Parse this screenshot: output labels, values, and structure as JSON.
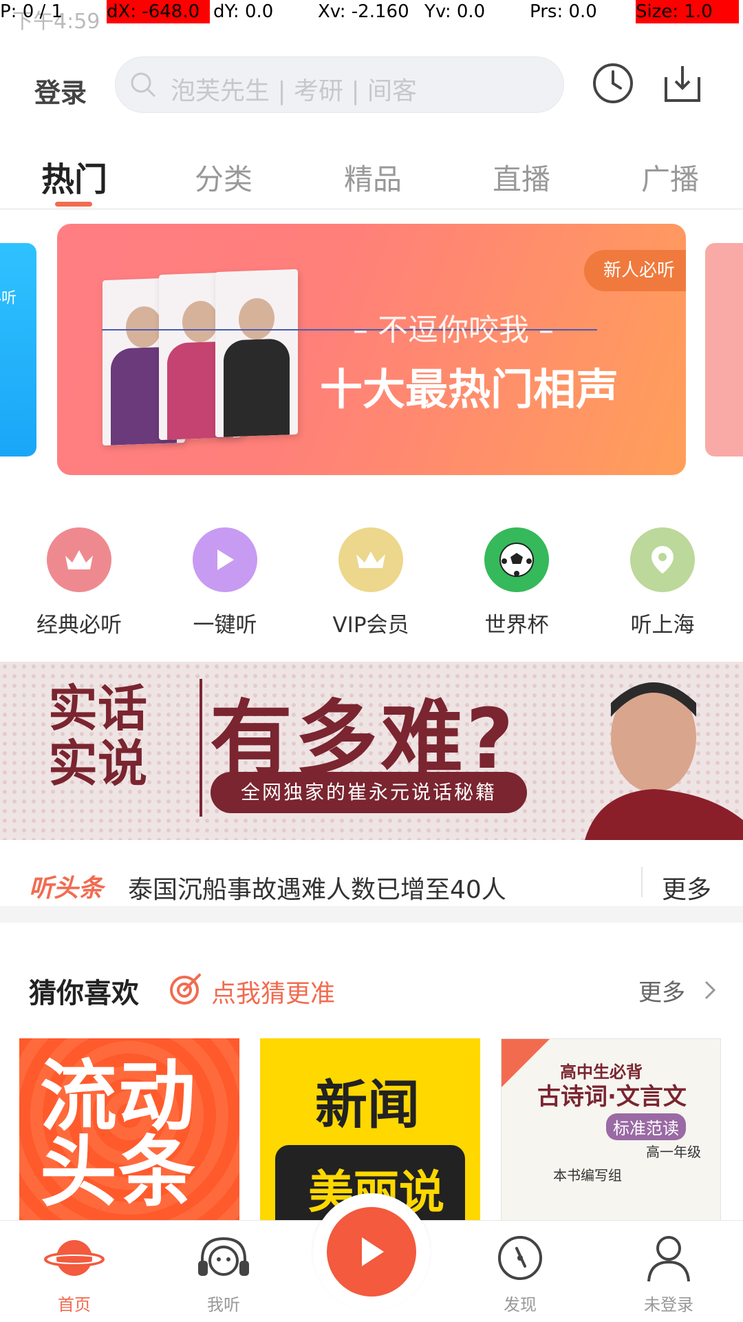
{
  "status_bar": {
    "time": "下午4:59"
  },
  "debug_overlay": {
    "pointer": "P: 0 / 1",
    "dx": "dX: -648.0",
    "dy": "dY: 0.0",
    "xv": "Xv: -2.160",
    "yv": "Yv: 0.0",
    "prs": "Prs: 0.0",
    "size": "Size: 1.0"
  },
  "header": {
    "login_label": "登录",
    "search_placeholder": "泡芙先生 | 考研 | 间客"
  },
  "tabs": [
    {
      "label": "热门",
      "active": true
    },
    {
      "label": "分类",
      "active": false
    },
    {
      "label": "精品",
      "active": false
    },
    {
      "label": "直播",
      "active": false
    },
    {
      "label": "广播",
      "active": false
    }
  ],
  "banner": {
    "left_peek_text": "必听",
    "tag": "新人必听",
    "subtitle": "– 不逗你咬我 –",
    "title": "十大最热门相声"
  },
  "quick_links": [
    {
      "label": "经典必听",
      "icon": "crown-icon",
      "color": "#ee8a8f"
    },
    {
      "label": "一键听",
      "icon": "play-icon",
      "color": "#c79bf2"
    },
    {
      "label": "VIP会员",
      "icon": "vip-crown-icon",
      "color": "#ecd78c"
    },
    {
      "label": "世界杯",
      "icon": "soccer-ball-icon",
      "color": "#35b95a"
    },
    {
      "label": "听上海",
      "icon": "location-pin-icon",
      "color": "#bcd89a"
    }
  ],
  "promo": {
    "left_title_line1": "实话",
    "left_title_line2": "实说",
    "big_text": "有多难?",
    "pill_text": "全网独家的崔永元说话秘籍"
  },
  "headline": {
    "tag": "听头条",
    "text": "泰国沉船事故遇难人数已增至40人",
    "more_label": "更多"
  },
  "guess": {
    "title": "猜你喜欢",
    "link_text": "点我猜更准",
    "more_label": "更多"
  },
  "cards": [
    {
      "title_line1": "流动",
      "title_line2": "头条"
    },
    {
      "title_line1": "新闻",
      "title_line2": "美丽说"
    },
    {
      "line1": "高中生必背",
      "line2": "古诗词·文言文",
      "line3": "标准范读",
      "line4": "高一年级",
      "line5": "本书编写组"
    }
  ],
  "bottom_nav": [
    {
      "label": "首页",
      "active": true
    },
    {
      "label": "我听",
      "active": false
    },
    {
      "label": "发现",
      "active": false
    },
    {
      "label": "未登录",
      "active": false
    }
  ],
  "colors": {
    "accent": "#f26b4f",
    "play_button": "#f35a3e"
  }
}
